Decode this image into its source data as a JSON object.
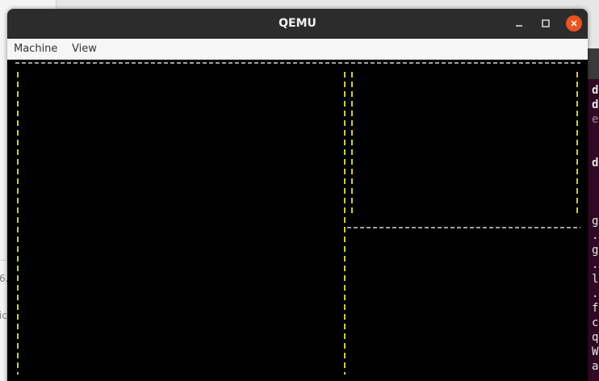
{
  "window": {
    "title": "QEMU"
  },
  "menubar": {
    "items": [
      {
        "label": "Machine"
      },
      {
        "label": "View"
      }
    ]
  },
  "background": {
    "left_window_fragments": [
      "6.",
      "ic"
    ],
    "terminal_fragment_chars": [
      "d",
      "d",
      "e",
      "d",
      "g",
      ".",
      "g",
      ".",
      "l",
      ".",
      "f",
      "c",
      "q",
      "W",
      "a"
    ]
  },
  "colors": {
    "titlebar": "#2c2c2c",
    "close_button": "#e95420",
    "vm_background": "#000000",
    "panel_border_white": "#ffffff",
    "panel_border_yellow": "#ffff55"
  },
  "icons": {
    "minimize": "minimize-icon",
    "maximize": "maximize-icon",
    "close": "close-icon"
  }
}
